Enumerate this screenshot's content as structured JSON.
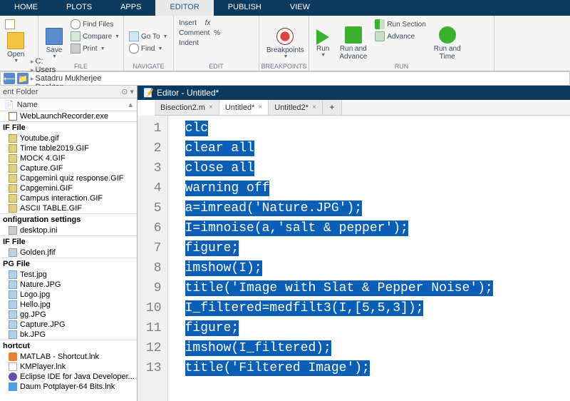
{
  "main_tabs": [
    "HOME",
    "PLOTS",
    "APPS",
    "EDITOR",
    "PUBLISH",
    "VIEW"
  ],
  "active_main_tab": "EDITOR",
  "ribbon": {
    "file": {
      "label": "FILE",
      "open": "Open",
      "save": "Save",
      "find_files": "Find Files",
      "compare": "Compare",
      "print": "Print"
    },
    "navigate": {
      "label": "NAVIGATE",
      "goto": "Go To",
      "find": "Find"
    },
    "edit": {
      "label": "EDIT",
      "insert": "Insert",
      "comment": "Comment",
      "indent": "Indent",
      "fx": "fx"
    },
    "breakpoints": {
      "label": "BREAKPOINTS",
      "breakpoints": "Breakpoints"
    },
    "run": {
      "label": "RUN",
      "run": "Run",
      "run_and_advance": "Run and\nAdvance",
      "run_section": "Run Section",
      "advance": "Advance",
      "run_and_time": "Run and\nTime"
    }
  },
  "path": [
    "C:",
    "Users",
    "Satadru Mukherjee",
    "Desktop"
  ],
  "left_panel": {
    "title": "ent Folder",
    "col_header": "Name",
    "groups": [
      {
        "hdr": "",
        "items": [
          {
            "name": "WebLaunchRecorder.exe",
            "icon": "fi-exe"
          }
        ]
      },
      {
        "hdr": "IF File",
        "items": [
          {
            "name": "Youtube.gif",
            "icon": "fi-gif"
          },
          {
            "name": "Time table2019.GIF",
            "icon": "fi-gif"
          },
          {
            "name": "MOCK 4.GIF",
            "icon": "fi-gif"
          },
          {
            "name": "Capture.GIF",
            "icon": "fi-gif"
          },
          {
            "name": "Capgemini quiz response.GIF",
            "icon": "fi-gif"
          },
          {
            "name": "Capgemini.GIF",
            "icon": "fi-gif"
          },
          {
            "name": "Campus interaction.GIF",
            "icon": "fi-gif"
          },
          {
            "name": "ASCII TABLE.GIF",
            "icon": "fi-gif"
          }
        ]
      },
      {
        "hdr": "onfiguration settings",
        "items": [
          {
            "name": "desktop.ini",
            "icon": "fi-cfg"
          }
        ]
      },
      {
        "hdr": "IF File",
        "items": [
          {
            "name": "Golden.jfif",
            "icon": "fi-jf"
          }
        ]
      },
      {
        "hdr": "PG File",
        "items": [
          {
            "name": "Test.jpg",
            "icon": "fi-jpg"
          },
          {
            "name": "Nature.JPG",
            "icon": "fi-jpg"
          },
          {
            "name": "Logo.jpg",
            "icon": "fi-jpg"
          },
          {
            "name": "Hello.jpg",
            "icon": "fi-jpg"
          },
          {
            "name": "gg.JPG",
            "icon": "fi-jpg"
          },
          {
            "name": "Capture.JPG",
            "icon": "fi-jpg"
          },
          {
            "name": "bk.JPG",
            "icon": "fi-jpg"
          }
        ]
      },
      {
        "hdr": "hortcut",
        "items": [
          {
            "name": "MATLAB - Shortcut.lnk",
            "icon": "fi-ml"
          },
          {
            "name": "KMPlayer.lnk",
            "icon": "fi-lnk"
          },
          {
            "name": "Eclipse IDE for Java Developer...",
            "icon": "fi-ec"
          },
          {
            "name": "Daum Potplayer-64 Bits.lnk",
            "icon": "fi-daum"
          }
        ]
      }
    ]
  },
  "editor": {
    "title": "Editor - Untitled*",
    "tabs": [
      {
        "label": "Bisection2.m",
        "active": false,
        "close": true
      },
      {
        "label": "Untitled*",
        "active": true,
        "close": true
      },
      {
        "label": "Untitled2*",
        "active": false,
        "close": true
      }
    ],
    "code": [
      "clc",
      "clear all",
      "close all",
      "warning off",
      "a=imread('Nature.JPG');",
      "I=imnoise(a,'salt & pepper');",
      "figure;",
      "imshow(I);",
      "title('Image with Slat & Pepper Noise');",
      "I_filtered=medfilt3(I,[5,5,3]);",
      "figure;",
      "imshow(I_filtered);",
      "title('Filtered Image');"
    ]
  }
}
